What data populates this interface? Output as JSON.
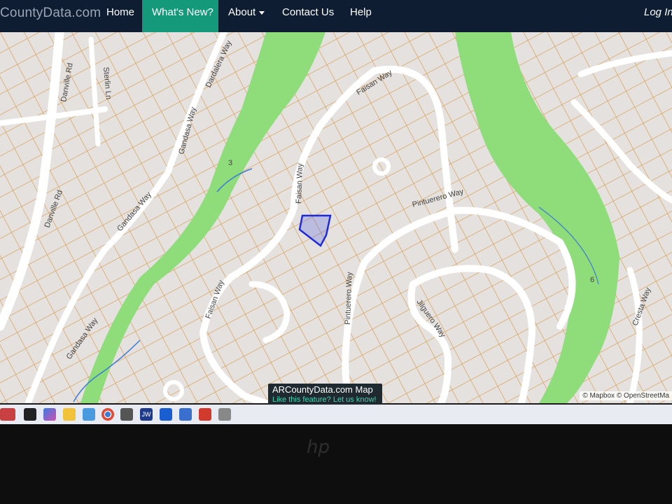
{
  "nav": {
    "brand": "County",
    "brand_suffix": "Data.com",
    "items": [
      {
        "label": "Home"
      },
      {
        "label": "What's New?"
      },
      {
        "label": "About"
      },
      {
        "label": "Contact Us"
      },
      {
        "label": "Help"
      }
    ],
    "login": "Log In",
    "active_color": "#149a7a",
    "bar_color": "#0f1d33"
  },
  "map": {
    "streets": {
      "danville_rd_1": "Danville Rd",
      "danville_rd_2": "Danville Rd",
      "gandasa_way_1": "Gandasa Way",
      "gandasa_way_2": "Gandasa Way",
      "gandasa_way_3": "Gandasa Way",
      "dardalera": "Dardalera Way",
      "faisan_way_1": "Faisan Way",
      "faisan_way_2": "Faisan Way",
      "faisan_way_3": "Faisan Way",
      "pintuerero_way_1": "Pintuerero Way",
      "pintuerero_way_2": "Pintuerero Way",
      "jilguero_way": "Jilguero Way",
      "cresta_way": "Cresta Way",
      "sterlin": "Sterlin Ln"
    },
    "markers": {
      "creek_3": "3",
      "creek_6": "6"
    },
    "attribution": "© Mapbox © OpenStreetMa",
    "tooltip_title": "ARCountyData.com Map",
    "tooltip_link": "Like this feature? Let us know!",
    "colors": {
      "parcel": "#d99a4a",
      "park": "#8fdc7a",
      "road": "#ffffff",
      "selected": "#1f2ad8",
      "water": "#3a7bd5"
    }
  },
  "taskbar": {
    "icons": [
      "widgets-icon",
      "file-explorer-icon",
      "copilot-icon",
      "folder-icon",
      "chrome-icon",
      "snipping-icon",
      "mail-icon",
      "jw-icon",
      "malwarebytes-icon",
      "calculator-icon",
      "acrobat-icon",
      "clipboard-icon"
    ],
    "jw_label": "JW"
  },
  "bezel": {
    "logo": "hp"
  }
}
